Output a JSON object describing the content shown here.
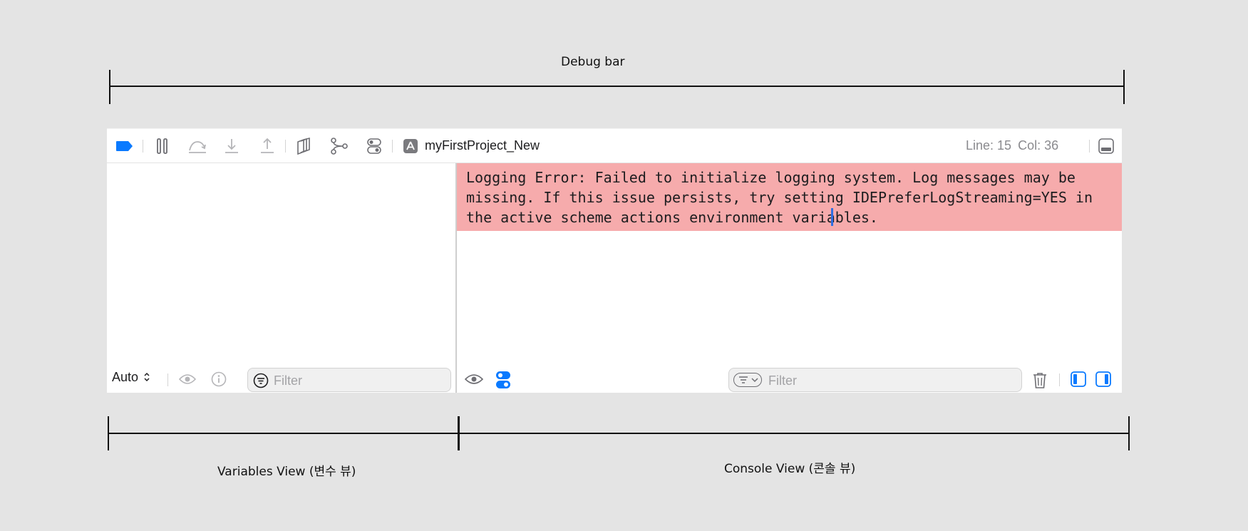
{
  "annotations": {
    "debug_bar": "Debug bar",
    "variables_view": "Variables View (변수 뷰)",
    "console_view": "Console View (콘솔 뷰)"
  },
  "debug_bar": {
    "process_name": "myFirstProject_New",
    "line_label": "Line: 15",
    "col_label": "Col: 36",
    "icons": [
      "breakpoint-toggle-icon",
      "pause-icon",
      "step-over-icon",
      "step-into-icon",
      "step-out-icon",
      "view-hierarchy-icon",
      "memory-graph-icon",
      "environment-overrides-icon",
      "app-icon",
      "hide-debug-area-icon"
    ]
  },
  "variables_view": {
    "scope_select": "Auto",
    "filter_placeholder": "Filter"
  },
  "console_view": {
    "log_message": "Logging Error: Failed to initialize logging system. Log messages may be missing. If this issue persists, try setting IDEPreferLogStreaming=YES in the active scheme actions environment variables.",
    "filter_placeholder": "Filter"
  },
  "colors": {
    "accent": "#0a7aff",
    "error_background": "#f6abac",
    "background": "#e4e4e4"
  }
}
